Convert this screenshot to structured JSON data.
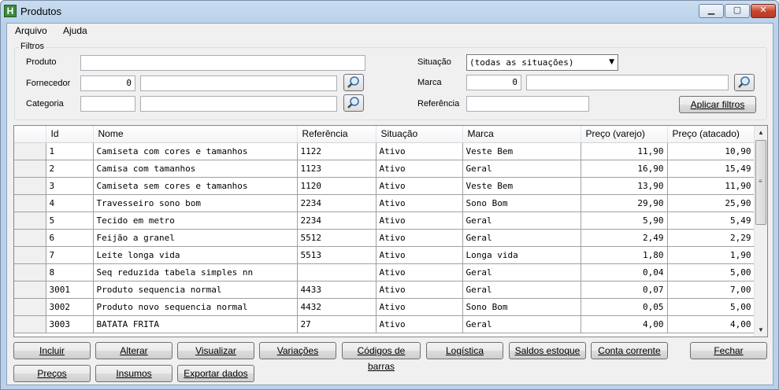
{
  "window": {
    "title": "Produtos",
    "app_icon_letter": "H"
  },
  "menu": {
    "items": [
      "Arquivo",
      "Ajuda"
    ]
  },
  "filters": {
    "group_label": "Filtros",
    "produto_label": "Produto",
    "produto_value": "",
    "fornecedor_label": "Fornecedor",
    "fornecedor_code": "0",
    "fornecedor_name": "",
    "categoria_label": "Categoria",
    "categoria_code": "",
    "categoria_name": "",
    "situacao_label": "Situação",
    "situacao_value": "(todas as situações)",
    "marca_label": "Marca",
    "marca_code": "0",
    "marca_name": "",
    "referencia_label": "Referência",
    "referencia_value": "",
    "apply_label": "Aplicar filtros"
  },
  "table": {
    "columns": [
      "Id",
      "Nome",
      "Referência",
      "Situação",
      "Marca",
      "Preço (varejo)",
      "Preço (atacado)"
    ],
    "rows": [
      [
        "1",
        "Camiseta com cores e tamanhos",
        "1122",
        "Ativo",
        "Veste Bem",
        "11,90",
        "10,90"
      ],
      [
        "2",
        "Camisa com tamanhos",
        "1123",
        "Ativo",
        "Geral",
        "16,90",
        "15,49"
      ],
      [
        "3",
        "Camiseta sem cores e tamanhos",
        "1120",
        "Ativo",
        "Veste Bem",
        "13,90",
        "11,90"
      ],
      [
        "4",
        "Travesseiro sono bom",
        "2234",
        "Ativo",
        "Sono Bom",
        "29,90",
        "25,90"
      ],
      [
        "5",
        "Tecido em metro",
        "2234",
        "Ativo",
        "Geral",
        "5,90",
        "5,49"
      ],
      [
        "6",
        "Feijão a granel",
        "5512",
        "Ativo",
        "Geral",
        "2,49",
        "2,29"
      ],
      [
        "7",
        "Leite longa vida",
        "5513",
        "Ativo",
        "Longa vida",
        "1,80",
        "1,90"
      ],
      [
        "8",
        "Seq reduzida tabela simples nn",
        "",
        "Ativo",
        "Geral",
        "0,04",
        "5,00"
      ],
      [
        "3001",
        "Produto sequencia normal",
        "4433",
        "Ativo",
        "Geral",
        "0,07",
        "7,00"
      ],
      [
        "3002",
        "Produto novo sequencia normal",
        "4432",
        "Ativo",
        "Sono Bom",
        "0,05",
        "5,00"
      ],
      [
        "3003",
        "BATATA FRITA",
        "27",
        "Ativo",
        "Geral",
        "4,00",
        "4,00"
      ]
    ]
  },
  "buttons": {
    "incluir": "Incluir",
    "alterar": "Alterar",
    "visualizar": "Visualizar",
    "variacoes": "Variações",
    "codigos": "Códigos de barras",
    "logistica": "Logística",
    "saldos": "Saldos estoque",
    "conta": "Conta corrente",
    "fechar": "Fechar",
    "precos": "Preços",
    "insumos": "Insumos",
    "exportar": "Exportar dados"
  },
  "colors": {
    "title_bar": "#b9d1ea",
    "client_bg": "#f0f0f0",
    "close_button": "#c8452c"
  }
}
